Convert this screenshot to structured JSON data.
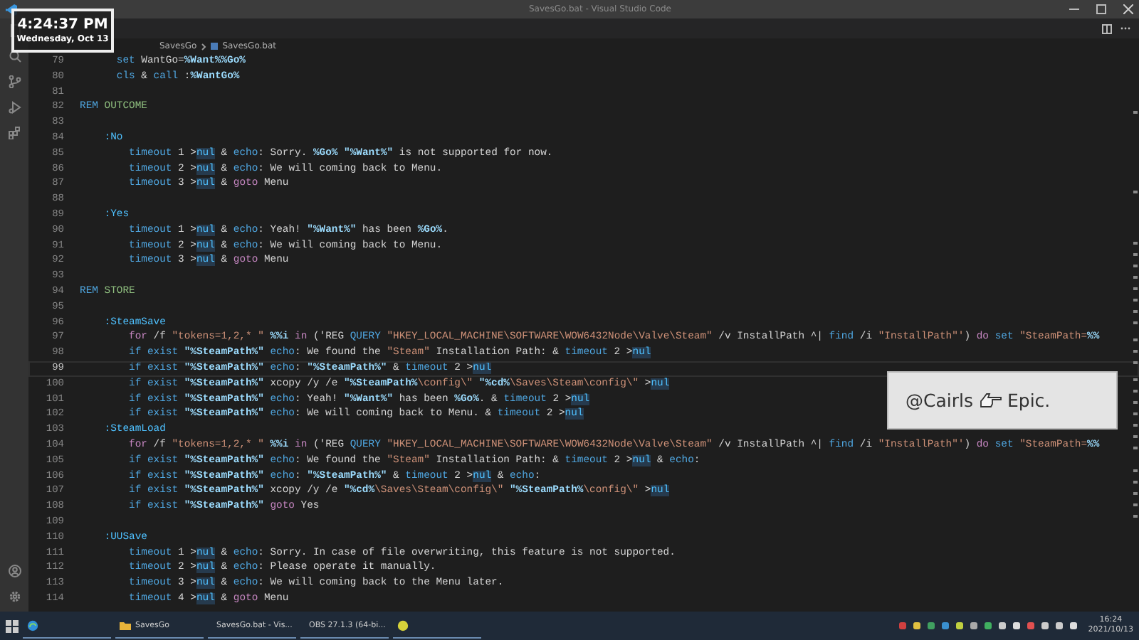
{
  "window": {
    "title": "SavesGo.bat - Visual Studio Code"
  },
  "breadcrumbs": [
    {
      "label": "SavesGo",
      "kind": "folder"
    },
    {
      "label": "SavesGo.bat",
      "kind": "file"
    }
  ],
  "editor": {
    "lines": [
      {
        "number": "79",
        "current": false,
        "tokens": [
          {
            "kind": "k",
            "text": "      set"
          },
          {
            "kind": "p",
            "text": " WantGo="
          },
          {
            "kind": "v",
            "text": "%Want%%Go%"
          }
        ]
      },
      {
        "number": "80",
        "current": false,
        "tokens": [
          {
            "kind": "k",
            "text": "      cls"
          },
          {
            "kind": "p",
            "text": " & "
          },
          {
            "kind": "k",
            "text": "call"
          },
          {
            "kind": "p",
            "text": " :"
          },
          {
            "kind": "v",
            "text": "%WantGo%"
          }
        ]
      },
      {
        "number": "81",
        "current": false
      },
      {
        "number": "82",
        "current": false,
        "tokens": [
          {
            "kind": "k",
            "text": "REM"
          },
          {
            "kind": "g",
            "text": " OUTCOME"
          }
        ]
      },
      {
        "number": "83",
        "current": false
      },
      {
        "number": "84",
        "current": false,
        "tokens": [
          {
            "kind": "l",
            "text": "    :No"
          }
        ]
      },
      {
        "number": "85",
        "current": false,
        "tokens": [
          {
            "kind": "k",
            "text": "        timeout"
          },
          {
            "kind": "p",
            "text": " 1 >"
          },
          {
            "kind": "n",
            "text": "nul"
          },
          {
            "kind": "p",
            "text": " & "
          },
          {
            "kind": "k",
            "text": "echo"
          },
          {
            "kind": "p",
            "text": ": Sorry. "
          },
          {
            "kind": "v",
            "text": "%Go%"
          },
          {
            "kind": "v",
            "text": " \"%Want%\""
          },
          {
            "kind": "p",
            "text": " is not supported for now."
          }
        ]
      },
      {
        "number": "86",
        "current": false,
        "tokens": [
          {
            "kind": "k",
            "text": "        timeout"
          },
          {
            "kind": "p",
            "text": " 2 >"
          },
          {
            "kind": "n",
            "text": "nul"
          },
          {
            "kind": "p",
            "text": " & "
          },
          {
            "kind": "k",
            "text": "echo"
          },
          {
            "kind": "p",
            "text": ": We will coming back to Menu."
          }
        ]
      },
      {
        "number": "87",
        "current": false,
        "tokens": [
          {
            "kind": "k",
            "text": "        timeout"
          },
          {
            "kind": "p",
            "text": " 3 >"
          },
          {
            "kind": "n",
            "text": "nul"
          },
          {
            "kind": "p",
            "text": " & "
          },
          {
            "kind": "c",
            "text": "goto"
          },
          {
            "kind": "p",
            "text": " Menu"
          }
        ]
      },
      {
        "number": "88",
        "current": false
      },
      {
        "number": "89",
        "current": false,
        "tokens": [
          {
            "kind": "l",
            "text": "    :Yes"
          }
        ]
      },
      {
        "number": "90",
        "current": false,
        "tokens": [
          {
            "kind": "k",
            "text": "        timeout"
          },
          {
            "kind": "p",
            "text": " 1 >"
          },
          {
            "kind": "n",
            "text": "nul"
          },
          {
            "kind": "p",
            "text": " & "
          },
          {
            "kind": "k",
            "text": "echo"
          },
          {
            "kind": "p",
            "text": ": Yeah! "
          },
          {
            "kind": "v",
            "text": "\"%Want%\""
          },
          {
            "kind": "p",
            "text": " has been "
          },
          {
            "kind": "v",
            "text": "%Go%"
          },
          {
            "kind": "p",
            "text": "."
          }
        ]
      },
      {
        "number": "91",
        "current": false,
        "tokens": [
          {
            "kind": "k",
            "text": "        timeout"
          },
          {
            "kind": "p",
            "text": " 2 >"
          },
          {
            "kind": "n",
            "text": "nul"
          },
          {
            "kind": "p",
            "text": " & "
          },
          {
            "kind": "k",
            "text": "echo"
          },
          {
            "kind": "p",
            "text": ": We will coming back to Menu."
          }
        ]
      },
      {
        "number": "92",
        "current": false,
        "tokens": [
          {
            "kind": "k",
            "text": "        timeout"
          },
          {
            "kind": "p",
            "text": " 3 >"
          },
          {
            "kind": "n",
            "text": "nul"
          },
          {
            "kind": "p",
            "text": " & "
          },
          {
            "kind": "c",
            "text": "goto"
          },
          {
            "kind": "p",
            "text": " Menu"
          }
        ]
      },
      {
        "number": "93",
        "current": false
      },
      {
        "number": "94",
        "current": false,
        "tokens": [
          {
            "kind": "k",
            "text": "REM"
          },
          {
            "kind": "g",
            "text": " STORE"
          }
        ]
      },
      {
        "number": "95",
        "current": false
      },
      {
        "number": "96",
        "current": false,
        "tokens": [
          {
            "kind": "l",
            "text": "    :SteamSave"
          }
        ]
      },
      {
        "number": "97",
        "current": false,
        "tokens": [
          {
            "kind": "c",
            "text": "        for"
          },
          {
            "kind": "p",
            "text": " /f "
          },
          {
            "kind": "s",
            "text": "\"tokens=1,2,* \""
          },
          {
            "kind": "v",
            "text": " %%i"
          },
          {
            "kind": "c",
            "text": " in"
          },
          {
            "kind": "p",
            "text": " ('REG "
          },
          {
            "kind": "k",
            "text": "QUERY"
          },
          {
            "kind": "s",
            "text": " \"HKEY_LOCAL_MACHINE\\SOFTWARE\\WOW6432Node\\Valve\\Steam\""
          },
          {
            "kind": "p",
            "text": " /v InstallPath ^| "
          },
          {
            "kind": "k",
            "text": "find"
          },
          {
            "kind": "p",
            "text": " /i "
          },
          {
            "kind": "s",
            "text": "\"InstallPath\"'"
          },
          {
            "kind": "p",
            "text": ") "
          },
          {
            "kind": "c",
            "text": "do"
          },
          {
            "kind": "k",
            "text": " set"
          },
          {
            "kind": "s",
            "text": " \"SteamPath="
          },
          {
            "kind": "v",
            "text": "%%"
          }
        ]
      },
      {
        "number": "98",
        "current": false,
        "tokens": [
          {
            "kind": "k",
            "text": "        if exist"
          },
          {
            "kind": "v",
            "text": " \"%SteamPath%\""
          },
          {
            "kind": "k",
            "text": " echo"
          },
          {
            "kind": "p",
            "text": ": We found the "
          },
          {
            "kind": "s",
            "text": "\"Steam\""
          },
          {
            "kind": "p",
            "text": " Installation Path: & "
          },
          {
            "kind": "k",
            "text": "timeout"
          },
          {
            "kind": "p",
            "text": " 2 >"
          },
          {
            "kind": "n",
            "text": "nul"
          }
        ]
      },
      {
        "number": "99",
        "current": true,
        "tokens": [
          {
            "kind": "k",
            "text": "        if exist"
          },
          {
            "kind": "v",
            "text": " \"%SteamPath%\""
          },
          {
            "kind": "k",
            "text": " echo"
          },
          {
            "kind": "p",
            "text": ": "
          },
          {
            "kind": "v",
            "text": "\"%SteamPath%\""
          },
          {
            "kind": "p",
            "text": " & "
          },
          {
            "kind": "k",
            "text": "timeout"
          },
          {
            "kind": "p",
            "text": " 2 >"
          },
          {
            "kind": "n",
            "text": "nul"
          }
        ]
      },
      {
        "number": "100",
        "current": false,
        "tokens": [
          {
            "kind": "k",
            "text": "        if exist"
          },
          {
            "kind": "v",
            "text": " \"%SteamPath%\""
          },
          {
            "kind": "p",
            "text": " xcopy /y /e "
          },
          {
            "kind": "v",
            "text": "\"%SteamPath%"
          },
          {
            "kind": "s",
            "text": "\\config\\\""
          },
          {
            "kind": "v",
            "text": " \"%cd%"
          },
          {
            "kind": "s",
            "text": "\\Saves\\Steam\\config\\\""
          },
          {
            "kind": "p",
            "text": " >"
          },
          {
            "kind": "n",
            "text": "nul"
          }
        ]
      },
      {
        "number": "101",
        "current": false,
        "tokens": [
          {
            "kind": "k",
            "text": "        if exist"
          },
          {
            "kind": "v",
            "text": " \"%SteamPath%\""
          },
          {
            "kind": "k",
            "text": " echo"
          },
          {
            "kind": "p",
            "text": ": Yeah! "
          },
          {
            "kind": "v",
            "text": "\"%Want%\""
          },
          {
            "kind": "p",
            "text": " has been "
          },
          {
            "kind": "v",
            "text": "%Go%"
          },
          {
            "kind": "p",
            "text": ". & "
          },
          {
            "kind": "k",
            "text": "timeout"
          },
          {
            "kind": "p",
            "text": " 2 >"
          },
          {
            "kind": "n",
            "text": "nul"
          }
        ]
      },
      {
        "number": "102",
        "current": false,
        "tokens": [
          {
            "kind": "k",
            "text": "        if exist"
          },
          {
            "kind": "v",
            "text": " \"%SteamPath%\""
          },
          {
            "kind": "k",
            "text": " echo"
          },
          {
            "kind": "p",
            "text": ": We will coming back to Menu. & "
          },
          {
            "kind": "k",
            "text": "timeout"
          },
          {
            "kind": "p",
            "text": " 2 >"
          },
          {
            "kind": "n",
            "text": "nul"
          }
        ]
      },
      {
        "number": "103",
        "current": false,
        "tokens": [
          {
            "kind": "l",
            "text": "    :SteamLoad"
          }
        ]
      },
      {
        "number": "104",
        "current": false,
        "tokens": [
          {
            "kind": "c",
            "text": "        for"
          },
          {
            "kind": "p",
            "text": " /f "
          },
          {
            "kind": "s",
            "text": "\"tokens=1,2,* \""
          },
          {
            "kind": "v",
            "text": " %%i"
          },
          {
            "kind": "c",
            "text": " in"
          },
          {
            "kind": "p",
            "text": " ('REG "
          },
          {
            "kind": "k",
            "text": "QUERY"
          },
          {
            "kind": "s",
            "text": " \"HKEY_LOCAL_MACHINE\\SOFTWARE\\WOW6432Node\\Valve\\Steam\""
          },
          {
            "kind": "p",
            "text": " /v InstallPath ^| "
          },
          {
            "kind": "k",
            "text": "find"
          },
          {
            "kind": "p",
            "text": " /i "
          },
          {
            "kind": "s",
            "text": "\"InstallPath\"'"
          },
          {
            "kind": "p",
            "text": ") "
          },
          {
            "kind": "c",
            "text": "do"
          },
          {
            "kind": "k",
            "text": " set"
          },
          {
            "kind": "s",
            "text": " \"SteamPath="
          },
          {
            "kind": "v",
            "text": "%%"
          }
        ]
      },
      {
        "number": "105",
        "current": false,
        "tokens": [
          {
            "kind": "k",
            "text": "        if exist"
          },
          {
            "kind": "v",
            "text": " \"%SteamPath%\""
          },
          {
            "kind": "k",
            "text": " echo"
          },
          {
            "kind": "p",
            "text": ": We found the "
          },
          {
            "kind": "s",
            "text": "\"Steam\""
          },
          {
            "kind": "p",
            "text": " Installation Path: & "
          },
          {
            "kind": "k",
            "text": "timeout"
          },
          {
            "kind": "p",
            "text": " 2 >"
          },
          {
            "kind": "n",
            "text": "nul"
          },
          {
            "kind": "p",
            "text": " & "
          },
          {
            "kind": "k",
            "text": "echo"
          },
          {
            "kind": "p",
            "text": ":"
          }
        ]
      },
      {
        "number": "106",
        "current": false,
        "tokens": [
          {
            "kind": "k",
            "text": "        if exist"
          },
          {
            "kind": "v",
            "text": " \"%SteamPath%\""
          },
          {
            "kind": "k",
            "text": " echo"
          },
          {
            "kind": "p",
            "text": ": "
          },
          {
            "kind": "v",
            "text": "\"%SteamPath%\""
          },
          {
            "kind": "p",
            "text": " & "
          },
          {
            "kind": "k",
            "text": "timeout"
          },
          {
            "kind": "p",
            "text": " 2 >"
          },
          {
            "kind": "n",
            "text": "nul"
          },
          {
            "kind": "p",
            "text": " & "
          },
          {
            "kind": "k",
            "text": "echo"
          },
          {
            "kind": "p",
            "text": ":"
          }
        ]
      },
      {
        "number": "107",
        "current": false,
        "tokens": [
          {
            "kind": "k",
            "text": "        if exist"
          },
          {
            "kind": "v",
            "text": " \"%SteamPath%\""
          },
          {
            "kind": "p",
            "text": " xcopy /y /e "
          },
          {
            "kind": "v",
            "text": "\"%cd%"
          },
          {
            "kind": "s",
            "text": "\\Saves\\Steam\\config\\\""
          },
          {
            "kind": "v",
            "text": " \"%SteamPath%"
          },
          {
            "kind": "s",
            "text": "\\config\\\""
          },
          {
            "kind": "p",
            "text": " >"
          },
          {
            "kind": "n",
            "text": "nul"
          }
        ]
      },
      {
        "number": "108",
        "current": false,
        "tokens": [
          {
            "kind": "k",
            "text": "        if exist"
          },
          {
            "kind": "v",
            "text": " \"%SteamPath%\""
          },
          {
            "kind": "c",
            "text": " goto"
          },
          {
            "kind": "p",
            "text": " Yes"
          }
        ]
      },
      {
        "number": "109",
        "current": false
      },
      {
        "number": "110",
        "current": false,
        "tokens": [
          {
            "kind": "l",
            "text": "    :UUSave"
          }
        ]
      },
      {
        "number": "111",
        "current": false,
        "tokens": [
          {
            "kind": "k",
            "text": "        timeout"
          },
          {
            "kind": "p",
            "text": " 1 >"
          },
          {
            "kind": "n",
            "text": "nul"
          },
          {
            "kind": "p",
            "text": " & "
          },
          {
            "kind": "k",
            "text": "echo"
          },
          {
            "kind": "p",
            "text": ": Sorry. In case of file overwriting, this feature is not supported."
          }
        ]
      },
      {
        "number": "112",
        "current": false,
        "tokens": [
          {
            "kind": "k",
            "text": "        timeout"
          },
          {
            "kind": "p",
            "text": " 2 >"
          },
          {
            "kind": "n",
            "text": "nul"
          },
          {
            "kind": "p",
            "text": " & "
          },
          {
            "kind": "k",
            "text": "echo"
          },
          {
            "kind": "p",
            "text": ": Please operate it manually."
          }
        ]
      },
      {
        "number": "113",
        "current": false,
        "tokens": [
          {
            "kind": "k",
            "text": "        timeout"
          },
          {
            "kind": "p",
            "text": " 3 >"
          },
          {
            "kind": "n",
            "text": "nul"
          },
          {
            "kind": "p",
            "text": " & "
          },
          {
            "kind": "k",
            "text": "echo"
          },
          {
            "kind": "p",
            "text": ": We will coming back to the Menu later."
          }
        ]
      },
      {
        "number": "114",
        "current": false,
        "tokens": [
          {
            "kind": "k",
            "text": "        timeout"
          },
          {
            "kind": "p",
            "text": " 4 >"
          },
          {
            "kind": "n",
            "text": "nul"
          },
          {
            "kind": "p",
            "text": " & "
          },
          {
            "kind": "c",
            "text": "goto"
          },
          {
            "kind": "p",
            "text": " Menu"
          }
        ]
      }
    ]
  },
  "clock_overlay": {
    "time": "4:24:37 PM",
    "date": "Wednesday, Oct 13"
  },
  "chat_overlay": {
    "user": "@Cairls",
    "message": "Epic."
  },
  "taskbar": {
    "items": [
      {
        "kind": "browser"
      },
      {
        "kind": "folder",
        "label": "SavesGo"
      },
      {
        "kind": "vscode",
        "label": "SavesGo.bat - Vis..."
      },
      {
        "kind": "obs",
        "label": "OBS 27.1.3 (64-bi..."
      },
      {
        "kind": "app"
      }
    ],
    "time": "16:24",
    "date": "2021/10/13"
  }
}
